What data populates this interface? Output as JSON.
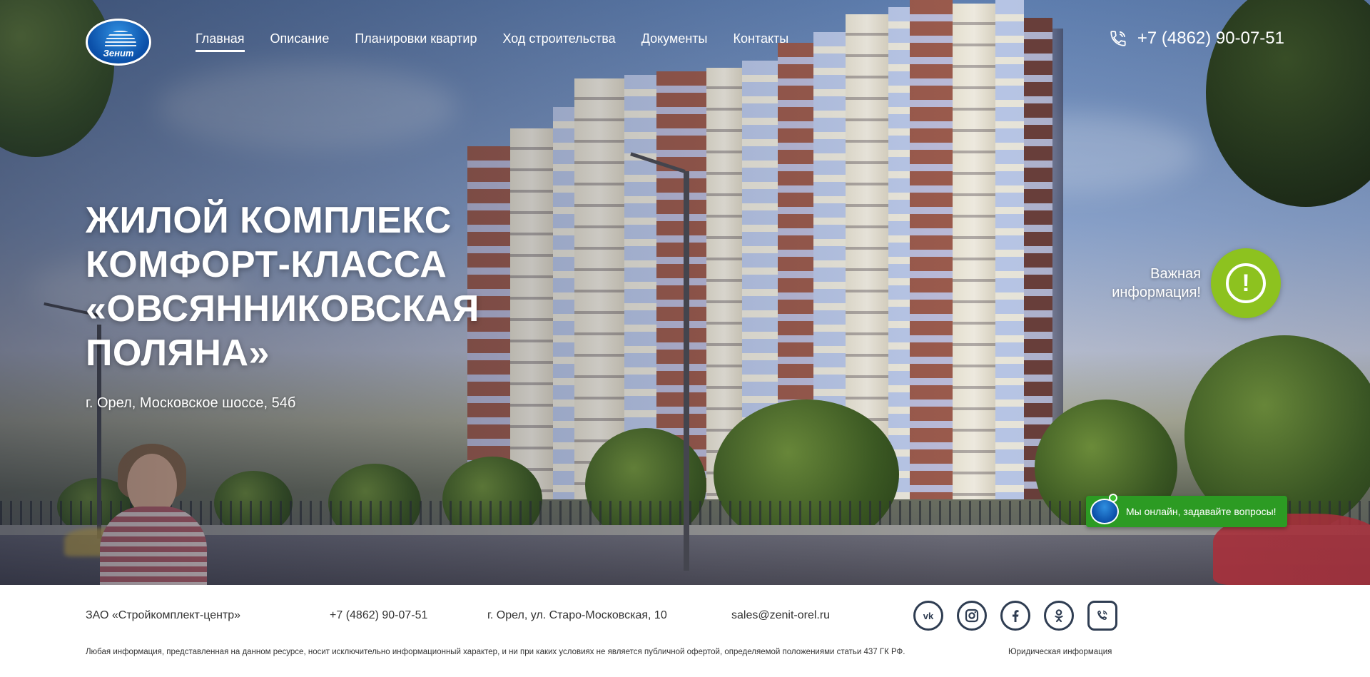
{
  "brand": {
    "logo_text": "Зенит"
  },
  "nav": {
    "items": [
      {
        "label": "Главная",
        "active": true
      },
      {
        "label": "Описание"
      },
      {
        "label": "Планировки квартир"
      },
      {
        "label": "Ход строительства"
      },
      {
        "label": "Документы"
      },
      {
        "label": "Контакты"
      }
    ]
  },
  "header": {
    "phone": "+7 (4862) 90-07-51",
    "phone_icon": "phone-icon"
  },
  "hero": {
    "title_lines": [
      "ЖИЛОЙ КОМПЛЕКС",
      "КОМФОРТ-КЛАССА",
      "«ОВСЯННИКОВСКАЯ",
      "ПОЛЯНА»"
    ],
    "address": "г. Орел, Московское шоссе, 54б"
  },
  "important": {
    "label_line1": "Важная",
    "label_line2": "информация!",
    "icon": "exclamation-icon",
    "color": "#8dc21f"
  },
  "chat": {
    "label": "Мы онлайн, задавайте вопросы!",
    "color": "#2c9b23"
  },
  "footer": {
    "company": "ЗАО «Стройкомплект-центр»",
    "phone": "+7 (4862) 90-07-51",
    "address": "г. Орел, ул. Старо-Московская, 10",
    "email": "sales@zenit-orel.ru",
    "socials": [
      "vk-icon",
      "instagram-icon",
      "facebook-icon",
      "odnoklassniki-icon",
      "viber-icon"
    ],
    "disclaimer": "Любая информация, представленная на данном ресурсе, носит исключительно информационный характер, и ни при каких условиях не является публичной офертой, определяемой положениями статьи 437 ГК РФ.",
    "legal_link": "Юридическая информация"
  }
}
